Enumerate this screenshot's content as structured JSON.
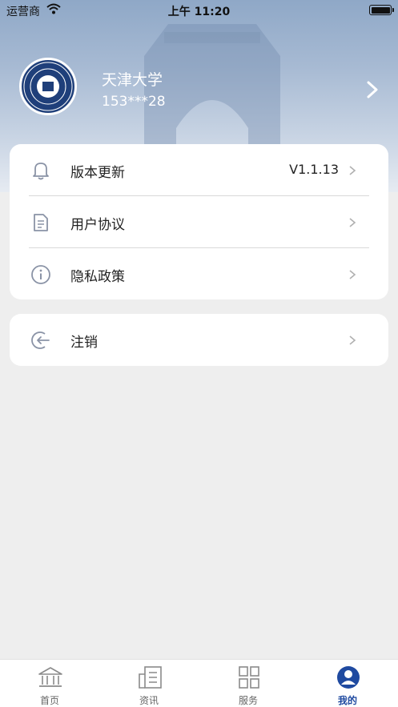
{
  "status_bar": {
    "carrier": "运营商",
    "time": "上午 11:20"
  },
  "profile": {
    "name": "天津大学",
    "phone": "153***28"
  },
  "menu": {
    "items": [
      {
        "label": "版本更新",
        "value": "V1.1.13",
        "icon": "bell-icon"
      },
      {
        "label": "用户协议",
        "value": "",
        "icon": "document-icon"
      },
      {
        "label": "隐私政策",
        "value": "",
        "icon": "info-icon"
      }
    ],
    "logout": {
      "label": "注销",
      "icon": "logout-icon"
    }
  },
  "tabbar": {
    "tabs": [
      {
        "label": "首页",
        "icon": "home-icon",
        "active": false
      },
      {
        "label": "资讯",
        "icon": "news-icon",
        "active": false
      },
      {
        "label": "服务",
        "icon": "grid-icon",
        "active": false
      },
      {
        "label": "我的",
        "icon": "user-icon",
        "active": true
      }
    ]
  },
  "colors": {
    "accent": "#1f4aa0",
    "background": "#eeeeee",
    "header_gradient_top": "#8fa8c7"
  }
}
